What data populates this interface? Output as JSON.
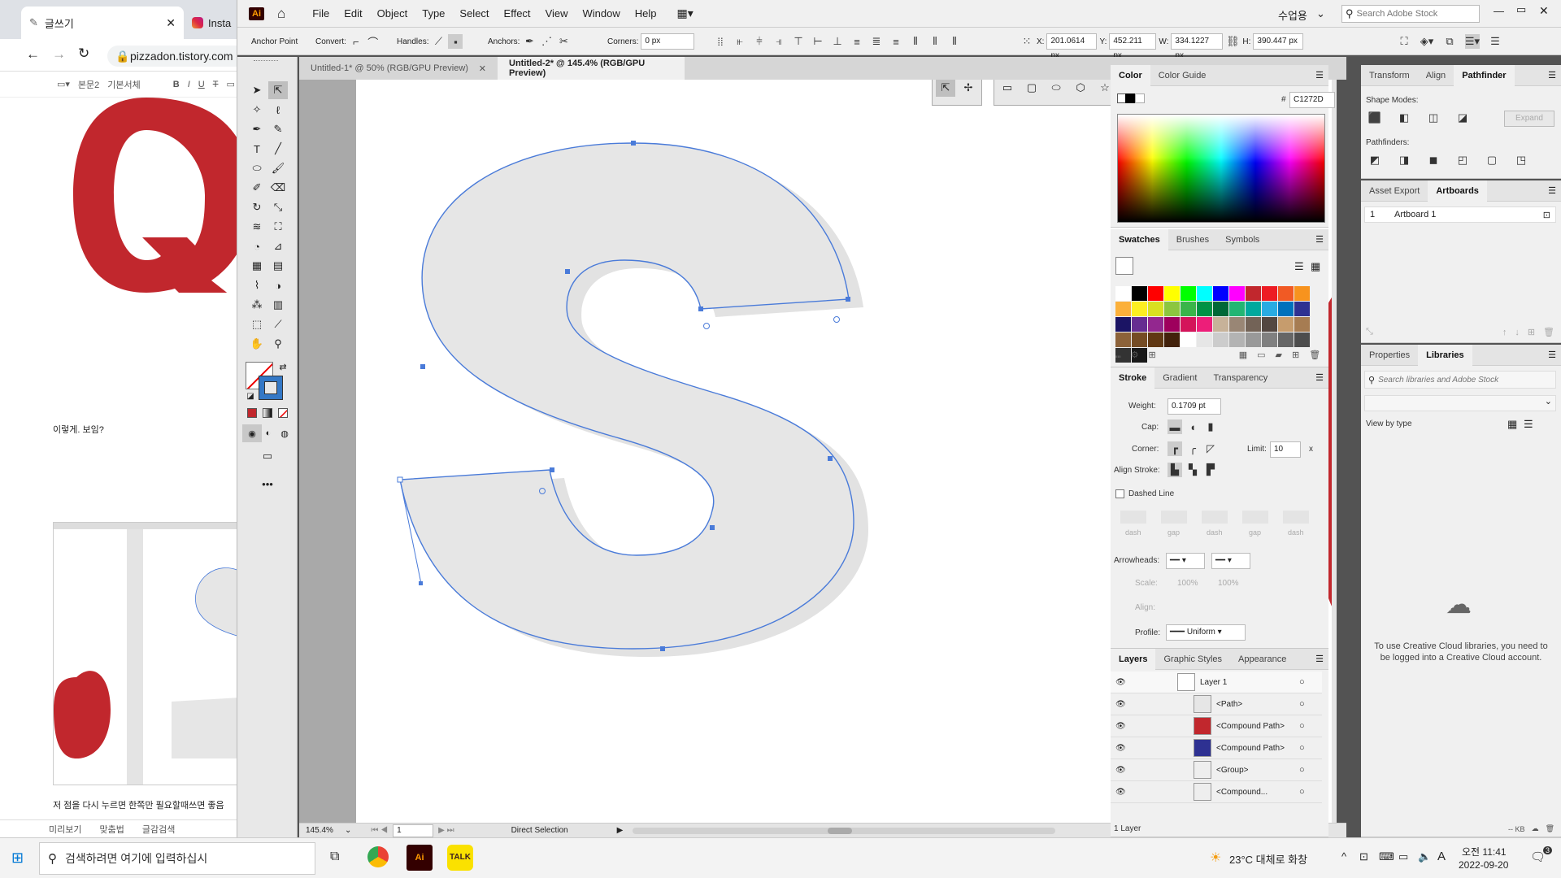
{
  "browser": {
    "tab1_title": "글쓰기",
    "tab2_title": "Insta",
    "url": "pizzadon.tistory.com",
    "editor_font": "본문2",
    "editor_style": "기본서체",
    "fmt_bold": "B",
    "fmt_italic": "I",
    "fmt_underline": "U",
    "fmt_strike": "T",
    "post_text_1": "이렇게. 보임?",
    "post_text_2": "저 점을 다시 누르면 한쪽만 필요할때쓰면 좋음",
    "foot_preview": "미리보기",
    "foot_spell": "맞춤법",
    "foot_check": "글감검색"
  },
  "menubar": {
    "app_icon": "Ai",
    "items": [
      "File",
      "Edit",
      "Object",
      "Type",
      "Select",
      "Effect",
      "View",
      "Window",
      "Help"
    ],
    "workspace": "수업용",
    "search_placeholder": "Search Adobe Stock"
  },
  "control": {
    "anchor_point": "Anchor Point",
    "convert": "Convert:",
    "handles": "Handles:",
    "anchors": "Anchors:",
    "corners": "Corners:",
    "corners_value": "0 px",
    "x_label": "X:",
    "x_value": "201.0614 px",
    "y_label": "Y:",
    "y_value": "452.211 px",
    "w_label": "W:",
    "w_value": "334.1227 px",
    "h_label": "H:",
    "h_value": "390.447 px"
  },
  "documents": {
    "tab1": "Untitled-1* @ 50% (RGB/GPU Preview)",
    "tab2": "Untitled-2* @ 145.4% (RGB/GPU Preview)"
  },
  "status": {
    "zoom": "145.4%",
    "artboard": "1",
    "tool": "Direct Selection"
  },
  "color_panel": {
    "tab_color": "Color",
    "tab_guide": "Color Guide",
    "hex_sign": "#",
    "hex": "C1272D"
  },
  "swatches_panel": {
    "tab_swatches": "Swatches",
    "tab_brushes": "Brushes",
    "tab_symbols": "Symbols",
    "colors": [
      "#ffffff",
      "#000000",
      "#ff0000",
      "#ffff00",
      "#00ff00",
      "#00ffff",
      "#0000ff",
      "#ff00ff",
      "#c1272d",
      "#ed1c24",
      "#f15a24",
      "#f7931e",
      "#fbb03b",
      "#fcee21",
      "#d9e021",
      "#8cc63f",
      "#39b54a",
      "#009245",
      "#006837",
      "#22b573",
      "#00a99d",
      "#29abe2",
      "#0071bc",
      "#2e3192",
      "#1b1464",
      "#662d91",
      "#93278f",
      "#9e005d",
      "#d4145a",
      "#ed1e79",
      "#c7b299",
      "#998675",
      "#736357",
      "#534741",
      "#c69c6d",
      "#a67c52",
      "#8c6239",
      "#754c24",
      "#603813",
      "#42210b",
      "#ffffff",
      "#e6e6e6",
      "#cccccc",
      "#b3b3b3",
      "#999999",
      "#808080",
      "#666666",
      "#4d4d4d",
      "#333333",
      "#1a1a1a"
    ]
  },
  "stroke_panel": {
    "tab_stroke": "Stroke",
    "tab_gradient": "Gradient",
    "tab_transparency": "Transparency",
    "weight_label": "Weight:",
    "weight": "0.1709 pt",
    "cap_label": "Cap:",
    "corner_label": "Corner:",
    "limit_label": "Limit:",
    "limit": "10",
    "limit_x": "x",
    "align_label": "Align Stroke:",
    "dashed": "Dashed Line",
    "dash": "dash",
    "gap": "gap",
    "arrowheads": "Arrowheads:",
    "scale": "Scale:",
    "scale1": "100%",
    "scale2": "100%",
    "align": "Align:",
    "profile": "Profile:",
    "profile_value": "Uniform"
  },
  "layers_panel": {
    "tab_layers": "Layers",
    "tab_graphic": "Graphic Styles",
    "tab_appearance": "Appearance",
    "rows": [
      "Layer 1",
      "<Path>",
      "<Compound Path>",
      "<Compound Path>",
      "<Group>",
      "<Compound..."
    ],
    "footer": "1 Layer"
  },
  "right_panel": {
    "tab_transform": "Transform",
    "tab_align": "Align",
    "tab_pathfinder": "Pathfinder",
    "shape_modes": "Shape Modes:",
    "expand": "Expand",
    "pathfinders": "Pathfinders:",
    "tab_asset": "Asset Export",
    "tab_artboards": "Artboards",
    "artboard_num": "1",
    "artboard_name": "Artboard 1",
    "tab_properties": "Properties",
    "tab_libraries": "Libraries",
    "lib_search": "Search libraries and Adobe Stock",
    "view_by": "View by type",
    "cc_message": "To use Creative Cloud libraries, you need to be logged into a Creative Cloud account.",
    "kb": "-- KB"
  },
  "taskbar": {
    "search": "검색하려면 여기에 입력하십시",
    "weather": "23°C 대체로 화창",
    "ime": "A",
    "time": "오전 11:41",
    "date": "2022-09-20",
    "notif": "3"
  },
  "colors": {
    "accent_red": "#c1272d",
    "path_blue": "#4a7bd9"
  }
}
